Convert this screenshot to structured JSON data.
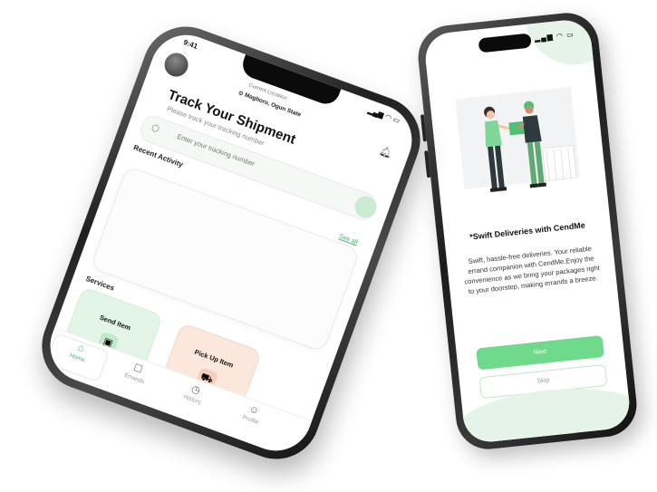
{
  "onboarding": {
    "title": "*Swift Deliveries with CendMe",
    "description": "Swift, hassle-free deliveries. Your reliable errand companion with CendMe.Enjoy the convenience as we bring your packages right to your doorstep, making errands a breeze.",
    "next_label": "Next",
    "skip_label": "Skip"
  },
  "home": {
    "time": "9:41",
    "location_label": "Current Location",
    "location_value": "Magboro, Ogun State",
    "title": "Track Your Shipment",
    "subtitle": "Please track your tracking number",
    "tracking_placeholder": "Enter your tracking number",
    "recent_activity_label": "Recent Activity",
    "see_all_label": "See all",
    "services_label": "Services",
    "services": [
      {
        "label": "Send Item",
        "icon": "box-icon"
      },
      {
        "label": "Pick Up Item",
        "icon": "truck-icon"
      }
    ],
    "nav": [
      {
        "label": "Home",
        "icon": "home-icon"
      },
      {
        "label": "Errands",
        "icon": "errands-icon"
      },
      {
        "label": "History",
        "icon": "history-icon"
      },
      {
        "label": "Profile",
        "icon": "profile-icon"
      }
    ]
  },
  "colors": {
    "accent_green": "#6fd98c",
    "light_green": "#e2f5e7",
    "light_peach": "#fbe7dc"
  }
}
